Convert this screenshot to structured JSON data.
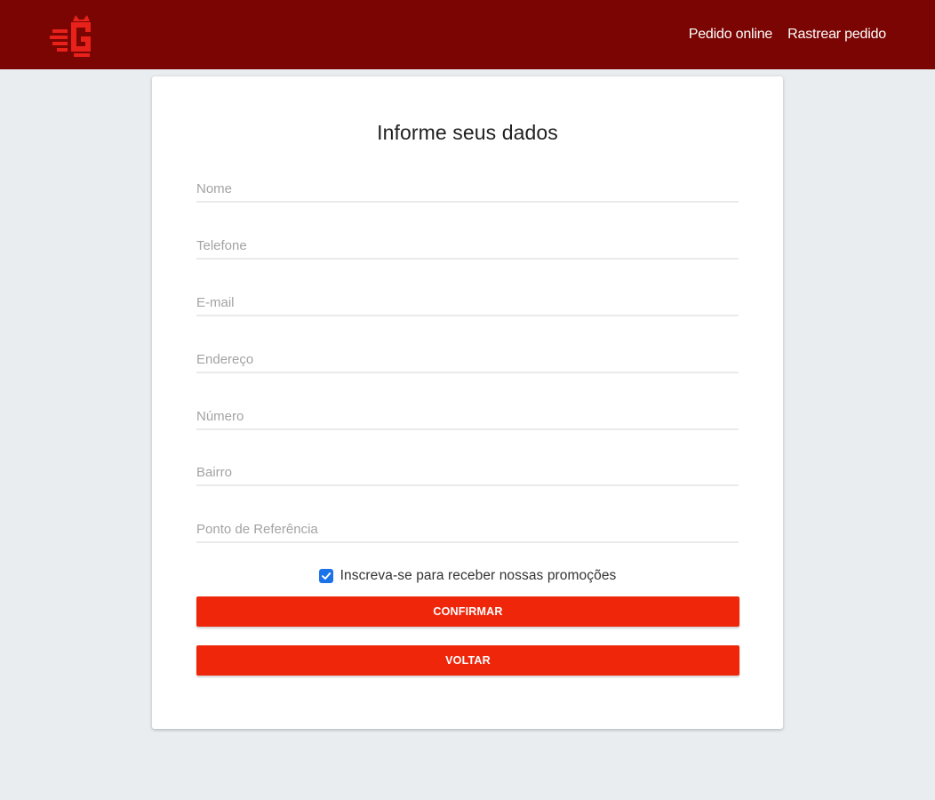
{
  "header": {
    "logo_icon": "brand-logo-icon",
    "nav": [
      {
        "label": "Pedido online"
      },
      {
        "label": "Rastrear pedido"
      }
    ],
    "background": "#7a0502"
  },
  "form": {
    "title": "Informe seus dados",
    "fields": [
      {
        "placeholder": "Nome",
        "value": ""
      },
      {
        "placeholder": "Telefone",
        "value": ""
      },
      {
        "placeholder": "E-mail",
        "value": ""
      },
      {
        "placeholder": "Endereço",
        "value": ""
      },
      {
        "placeholder": "Número",
        "value": ""
      },
      {
        "placeholder": "Bairro",
        "value": ""
      },
      {
        "placeholder": "Ponto de Referência",
        "value": ""
      }
    ],
    "promo": {
      "label": "Inscreva-se para receber nossas promoções",
      "checked": true
    },
    "confirm_label": "CONFIRMAR",
    "back_label": "VOLTAR",
    "button_color": "#f0260a",
    "checkbox_color": "#1a73e8"
  }
}
